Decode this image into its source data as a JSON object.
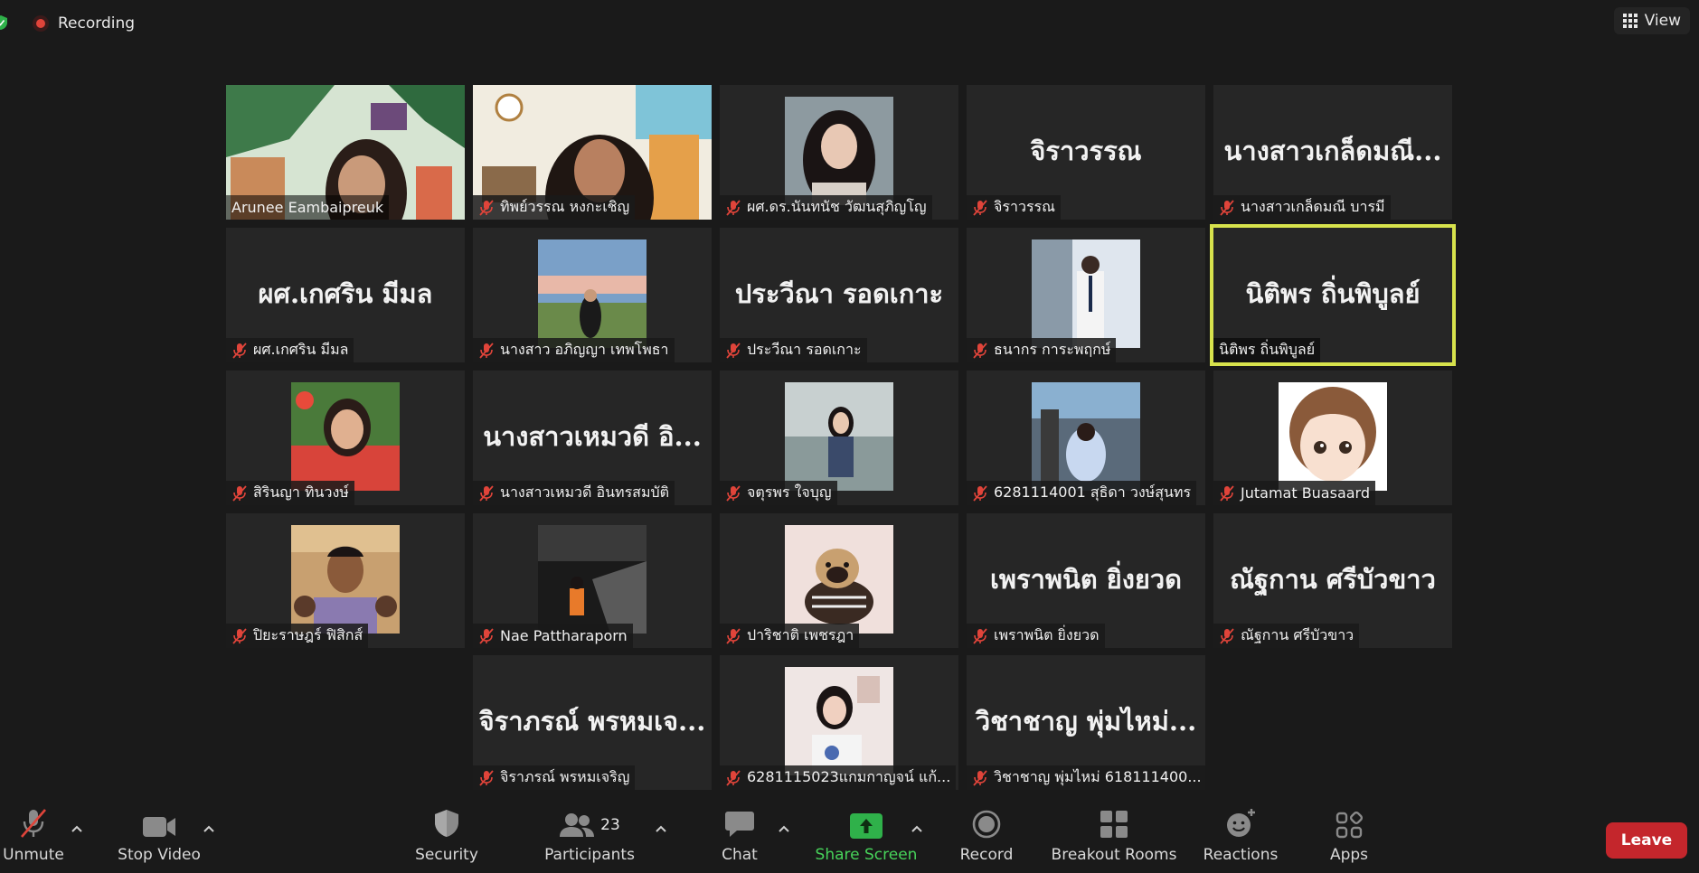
{
  "top": {
    "recording_label": "Recording",
    "view_label": "View"
  },
  "tiles": [
    {
      "name": "Arunee Eambaipreuk",
      "muted": false,
      "display": "video",
      "pic": "video-room-1"
    },
    {
      "name": "ทิพย์วรรณ หงกะเชิญ",
      "muted": true,
      "display": "video",
      "pic": "video-room-2"
    },
    {
      "name": "ผศ.ดร.นันทนัช วัฒนสุภิญโญ",
      "muted": true,
      "display": "photo",
      "pic": "portrait-1"
    },
    {
      "name": "จิราวรรณ",
      "muted": true,
      "display": "text",
      "big": "จิราวรรณ"
    },
    {
      "name": "นางสาวเกล็ดมณี บารมี",
      "muted": true,
      "display": "text",
      "big": "นางสาวเกล็ดมณี..."
    },
    {
      "name": "ผศ.เกศริน มีมล",
      "muted": true,
      "display": "text",
      "big": "ผศ.เกศริน มีมล"
    },
    {
      "name": "นางสาว อภิญญา เทพโพธา",
      "muted": true,
      "display": "photo",
      "pic": "portrait-field"
    },
    {
      "name": "ประวีณา รอดเกาะ",
      "muted": true,
      "display": "text",
      "big": "ประวีณา รอดเกาะ"
    },
    {
      "name": "ธนากร การะพฤกษ์",
      "muted": true,
      "display": "photo",
      "pic": "portrait-building"
    },
    {
      "name": "นิติพร ถิ่นพิบูลย์",
      "muted": false,
      "display": "text",
      "big": "นิติพร ถิ่นพิบูลย์",
      "active": true
    },
    {
      "name": "สิรินญา ทินวงษ์",
      "muted": true,
      "display": "photo",
      "pic": "portrait-red"
    },
    {
      "name": "นางสาวเหมวดี อินทรสมบัติ",
      "muted": true,
      "display": "text",
      "big": "นางสาวเหมวดี อิ..."
    },
    {
      "name": "จตุรพร ใจบุญ",
      "muted": true,
      "display": "photo",
      "pic": "portrait-2"
    },
    {
      "name": "6281114001 สุธิดา วงษ์สุนทร",
      "muted": true,
      "display": "photo",
      "pic": "portrait-street"
    },
    {
      "name": "Jutamat Buasaard",
      "muted": true,
      "display": "photo",
      "pic": "cartoon-girl"
    },
    {
      "name": "ปิยะราษฎร์ ฟิสิกส์",
      "muted": true,
      "display": "photo",
      "pic": "portrait-boy"
    },
    {
      "name": "Nae Pattharaporn",
      "muted": true,
      "display": "photo",
      "pic": "portrait-night"
    },
    {
      "name": "ปาริชาติ เพชรฎา",
      "muted": true,
      "display": "photo",
      "pic": "pug-dog"
    },
    {
      "name": "เพราพนิต ยิ่งยวด",
      "muted": true,
      "display": "text",
      "big": "เพราพนิต ยิ่งยวด"
    },
    {
      "name": "ณัฐกาน ศรีบัวขาว",
      "muted": true,
      "display": "text",
      "big": "ณัฐกาน ศรีบัวขาว"
    },
    {
      "name": "จิราภรณ์ พรหมเจริญ",
      "muted": true,
      "display": "text",
      "big": "จิราภรณ์ พรหมเจ..."
    },
    {
      "name": "6281115023แกมกาญจน์ แก้...",
      "muted": true,
      "display": "photo",
      "pic": "portrait-3"
    },
    {
      "name": "วิชาชาญ พุ่มไหม่ 618111400...",
      "muted": true,
      "display": "text",
      "big": "วิชาชาญ พุ่มไหม่..."
    }
  ],
  "toolbar": {
    "unmute": "Unmute",
    "stop_video": "Stop Video",
    "security": "Security",
    "participants": "Participants",
    "participants_count": "23",
    "chat": "Chat",
    "share_screen": "Share Screen",
    "record": "Record",
    "breakout_rooms": "Breakout Rooms",
    "reactions": "Reactions",
    "apps": "Apps",
    "leave": "Leave"
  },
  "colors": {
    "background": "#1a1a1a",
    "tile": "#262626",
    "active_speaker": "#d7e24c",
    "share_green": "#47d35a",
    "leave_red": "#c4262c",
    "mute_red": "#e0443a"
  }
}
